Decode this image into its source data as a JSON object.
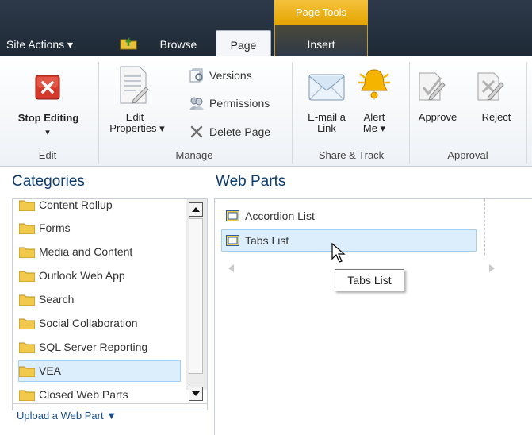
{
  "tabs": {
    "site_actions": "Site Actions ▾",
    "browse": "Browse",
    "page": "Page",
    "context_group": "Page Tools",
    "insert": "Insert"
  },
  "ribbon": {
    "edit_group": {
      "label": "Edit",
      "stop_editing": "Stop Editing",
      "stop_editing_arrow": "▾"
    },
    "manage_group": {
      "label": "Manage",
      "edit_properties_line1": "Edit",
      "edit_properties_line2": "Properties ▾",
      "versions": "Versions",
      "permissions": "Permissions",
      "delete_page": "Delete Page"
    },
    "share_group": {
      "label": "Share & Track",
      "email_link_line1": "E-mail a",
      "email_link_line2": "Link",
      "alert_me_line1": "Alert",
      "alert_me_line2": "Me ▾"
    },
    "approval_group": {
      "label": "Approval",
      "approve": "Approve",
      "reject": "Reject"
    }
  },
  "categories": {
    "title": "Categories",
    "items": [
      "Content Rollup",
      "Forms",
      "Media and Content",
      "Outlook Web App",
      "Search",
      "Social Collaboration",
      "SQL Server Reporting",
      "VEA",
      "Closed Web Parts"
    ],
    "selected": "VEA",
    "upload": "Upload a Web Part ▼"
  },
  "web_parts": {
    "title": "Web Parts",
    "items": [
      "Accordion List",
      "Tabs List"
    ],
    "selected": "Tabs List",
    "tooltip": "Tabs List"
  },
  "colors": {
    "topbar": "#1e2935",
    "context_group": "#e4a500",
    "selection": "#dceefb",
    "title_blue": "#0d3b6e"
  }
}
